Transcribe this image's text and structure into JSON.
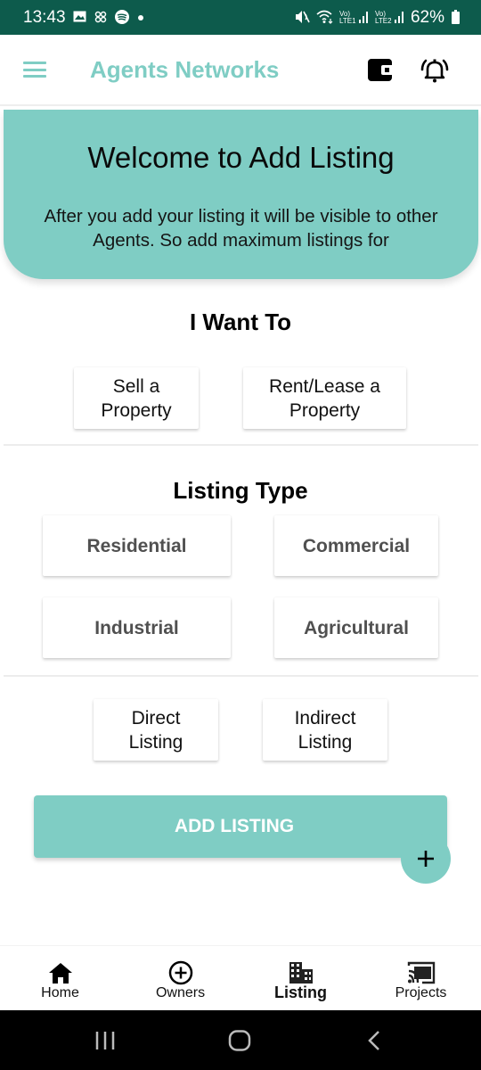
{
  "status_bar": {
    "time": "13:43",
    "left_icons": [
      "gallery-icon",
      "pinwheel-icon",
      "spotify-icon",
      "dot-icon"
    ],
    "right_icons": [
      "mute-icon",
      "wifi-icon",
      "lte1-signal-icon",
      "lte2-signal-icon"
    ],
    "lte1_label": "Vo) LTE1",
    "lte2_label": "Vo) LTE2",
    "battery": "62%"
  },
  "app_bar": {
    "title": "Agents Networks",
    "left_icon": "menu-icon",
    "right_icons": [
      "wallet-icon",
      "bell-icon"
    ]
  },
  "banner": {
    "title": "Welcome to Add Listing",
    "text": "After you add your listing it will be visible to other Agents. So add maximum listings for"
  },
  "want_to": {
    "title": "I Want To",
    "options": [
      {
        "line1": "Sell a",
        "line2": "Property"
      },
      {
        "line1": "Rent/Lease a",
        "line2": "Property"
      }
    ]
  },
  "listing_type": {
    "title": "Listing Type",
    "options": [
      "Residential",
      "Commercial",
      "Industrial",
      "Agricultural"
    ]
  },
  "listing_mode": {
    "options": [
      {
        "line1": "Direct",
        "line2": "Listing"
      },
      {
        "line1": "Indirect",
        "line2": "Listing"
      }
    ]
  },
  "add_listing_label": "ADD LISTING",
  "fab_icon": "plus-icon",
  "bottom_nav": {
    "items": [
      {
        "label": "Home",
        "icon": "home-icon",
        "active": false
      },
      {
        "label": "Owners",
        "icon": "add-circle-icon",
        "active": false
      },
      {
        "label": "Listing",
        "icon": "building-icon",
        "active": true
      },
      {
        "label": "Projects",
        "icon": "cast-icon",
        "active": false
      }
    ]
  },
  "system_nav": [
    "recents-icon",
    "home-circle-icon",
    "back-icon"
  ],
  "colors": {
    "accent": "#7fcdc4",
    "status_bar": "#0d5b4c",
    "card_bold_text": "#505050"
  }
}
